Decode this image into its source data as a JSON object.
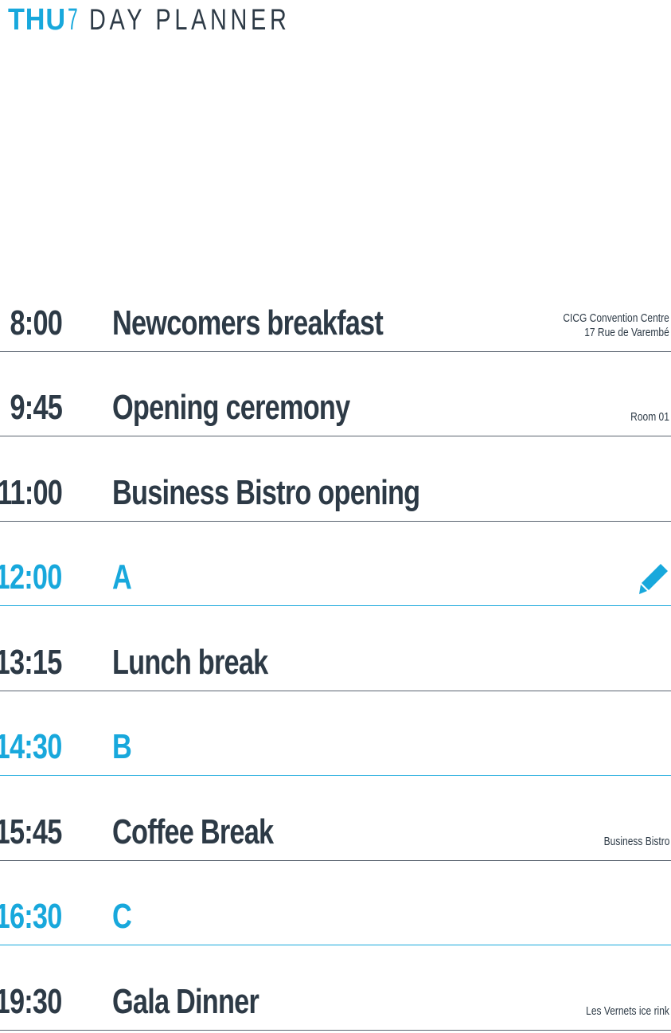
{
  "header": {
    "day": "THU",
    "date": "7",
    "title": "DAY PLANNER"
  },
  "colors": {
    "accent": "#18a8dc",
    "text": "#2d3a46",
    "divider": "#5a6470"
  },
  "schedule": [
    {
      "time": "8:00",
      "title": "Newcomers breakfast",
      "location": [
        "CICG Convention Centre",
        "17 Rue de Varembé"
      ],
      "highlight": false
    },
    {
      "time": "9:45",
      "title": "Opening ceremony",
      "location": [
        "Room 01"
      ],
      "highlight": false
    },
    {
      "time": "11:00",
      "title": "Business Bistro opening",
      "location": [],
      "highlight": false
    },
    {
      "time": "12:00",
      "title": "A",
      "location": [],
      "highlight": true,
      "icon": "pencil-icon"
    },
    {
      "time": "13:15",
      "title": "Lunch break",
      "location": [],
      "highlight": false
    },
    {
      "time": "14:30",
      "title": "B",
      "location": [],
      "highlight": true
    },
    {
      "time": "15:45",
      "title": "Coffee Break",
      "location": [
        "Business Bistro"
      ],
      "highlight": false
    },
    {
      "time": "16:30",
      "title": "C",
      "location": [],
      "highlight": true
    },
    {
      "time": "19:30",
      "title": "Gala Dinner",
      "location": [
        "Les Vernets ice rink"
      ],
      "highlight": false
    }
  ]
}
